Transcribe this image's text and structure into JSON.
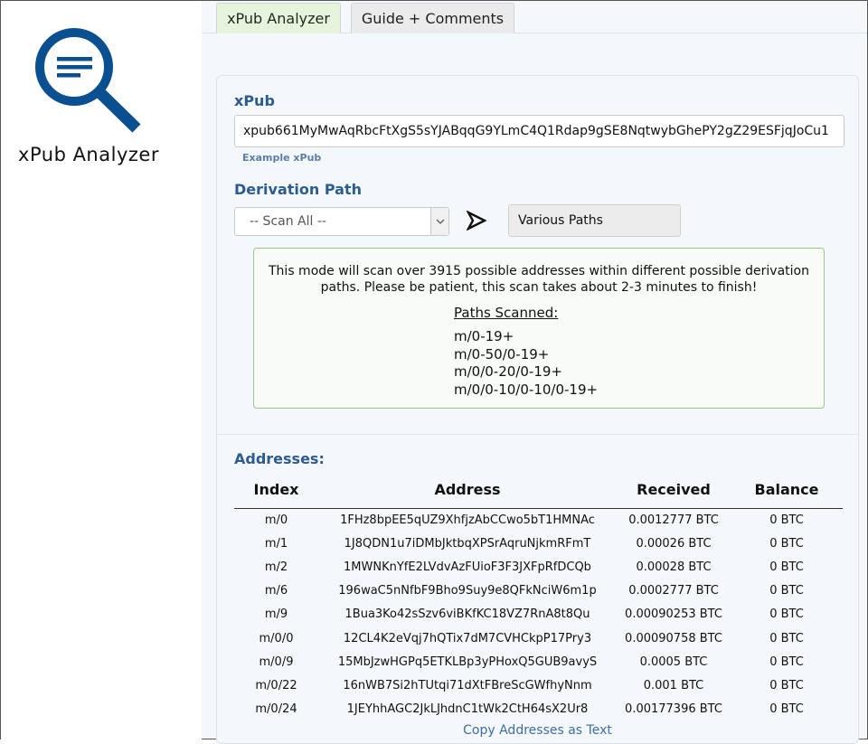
{
  "app": {
    "title": "xPub Analyzer",
    "logo_icon": "magnifier-document-icon",
    "accent_color": "#0a4f8f"
  },
  "tabs": [
    {
      "label": "xPub Analyzer",
      "active": true
    },
    {
      "label": "Guide + Comments",
      "active": false
    }
  ],
  "xpub": {
    "label": "xPub",
    "value": "xpub661MyMwAqRbcFtXgS5sYJABqqG9YLmC4Q1Rdap9gSE8NqtwybGhePY2gZ29ESFjqJoCu1",
    "example_link": "Example xPub"
  },
  "derivation": {
    "label": "Derivation Path",
    "selected": "-- Scan All --",
    "path_display": "Various Paths"
  },
  "info": {
    "message": "This mode will scan over 3915 possible addresses within different possible derivation paths. Please be patient, this scan takes about 2-3 minutes to finish!",
    "paths_title": "Paths Scanned:",
    "paths": [
      "m/0-19+",
      "m/0-50/0-19+",
      "m/0/0-20/0-19+",
      "m/0/0-10/0-10/0-19+"
    ]
  },
  "addresses": {
    "label": "Addresses:",
    "columns": [
      "Index",
      "Address",
      "Received",
      "Balance"
    ],
    "rows": [
      {
        "index": "m/0",
        "address": "1FHz8bpEE5qUZ9XhfjzAbCCwo5bT1HMNAc",
        "received": "0.0012777 BTC",
        "balance": "0 BTC"
      },
      {
        "index": "m/1",
        "address": "1J8QDN1u7iDMbJktbqXPSrAqruNjkmRFmT",
        "received": "0.00026 BTC",
        "balance": "0 BTC"
      },
      {
        "index": "m/2",
        "address": "1MWNKnYfE2LVdvAzFUioF3F3JXFpRfDCQb",
        "received": "0.00028 BTC",
        "balance": "0 BTC"
      },
      {
        "index": "m/6",
        "address": "196waC5nNfbF9Bho9Suy9e8QFkNciW6m1p",
        "received": "0.0002777 BTC",
        "balance": "0 BTC"
      },
      {
        "index": "m/9",
        "address": "1Bua3Ko42sSzv6viBKfKC18VZ7RnA8t8Qu",
        "received": "0.00090253 BTC",
        "balance": "0 BTC"
      },
      {
        "index": "m/0/0",
        "address": "12CL4K2eVqj7hQTix7dM7CVHCkpP17Pry3",
        "received": "0.00090758 BTC",
        "balance": "0 BTC"
      },
      {
        "index": "m/0/9",
        "address": "15MbJzwHGPq5ETKLBp3yPHoxQ5GUB9avyS",
        "received": "0.0005 BTC",
        "balance": "0 BTC"
      },
      {
        "index": "m/0/22",
        "address": "16nWB7Si2hTUtqi71dXtFBreScGWfhyNnm",
        "received": "0.001 BTC",
        "balance": "0 BTC"
      },
      {
        "index": "m/0/24",
        "address": "1JEYhhAGC2JkLJhdnC1tWk2CtH64sX2Ur8",
        "received": "0.00177396 BTC",
        "balance": "0 BTC"
      }
    ],
    "copy_link": "Copy Addresses as Text"
  }
}
